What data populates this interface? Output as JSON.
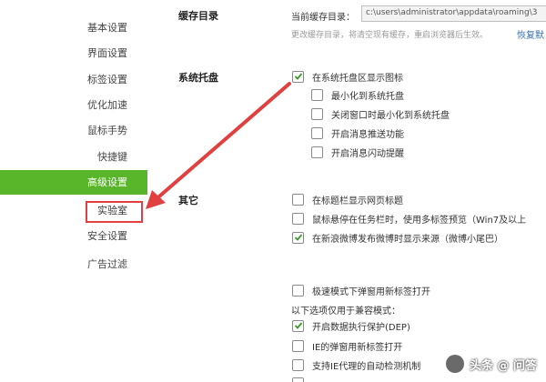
{
  "sidebar": {
    "items": [
      {
        "label": "基本设置"
      },
      {
        "label": "界面设置"
      },
      {
        "label": "标签设置"
      },
      {
        "label": "优化加速"
      },
      {
        "label": "鼠标手势"
      },
      {
        "label": "快捷键"
      },
      {
        "label": "高级设置"
      },
      {
        "label": "实验室"
      },
      {
        "label": "安全设置"
      },
      {
        "label": "广告过滤"
      }
    ],
    "active_index": 6,
    "highlighted_index": 7
  },
  "cache": {
    "title": "缓存目录",
    "current_label": "当前缓存目录：",
    "path": "c:\\users\\administrator\\appdata\\roaming\\3",
    "hint": "更改缓存目录，将清空现有缓存，重启浏览器后生效。",
    "restore_link": "恢复默"
  },
  "tray": {
    "title": "系统托盘",
    "options": [
      {
        "label": "在系统托盘区显示图标",
        "checked": true
      },
      {
        "label": "最小化到系统托盘",
        "checked": false
      },
      {
        "label": "关闭窗口时最小化到系统托盘",
        "checked": false
      },
      {
        "label": "开启消息推送功能",
        "checked": false
      },
      {
        "label": "开启消息闪动提醒",
        "checked": false
      }
    ]
  },
  "other": {
    "title": "其它",
    "options": [
      {
        "label": "在标题栏显示网页标题",
        "checked": false
      },
      {
        "label": "鼠标悬停在任务栏时，使用多标签预览（Win7及以上",
        "checked": false
      },
      {
        "label": "在新浪微博发布微博时显示来源（微博小尾巴）",
        "checked": true
      }
    ]
  },
  "speed": {
    "options": [
      {
        "label": "极速模式下弹窗用新标签打开",
        "checked": false
      }
    ],
    "compat_note": "以下选项仅用于兼容模式：",
    "compat_options": [
      {
        "label": "开启数据执行保护(DEP)",
        "checked": true
      },
      {
        "label": "IE的弹窗用新标签打开",
        "checked": false
      },
      {
        "label": "支持IE代理的自动检测机制",
        "checked": false
      }
    ]
  },
  "watermark": {
    "text": "头条 @ 问答"
  },
  "colors": {
    "accent_green": "#59b52a",
    "highlight_red": "#e04040",
    "link_blue": "#3a6fb5"
  }
}
